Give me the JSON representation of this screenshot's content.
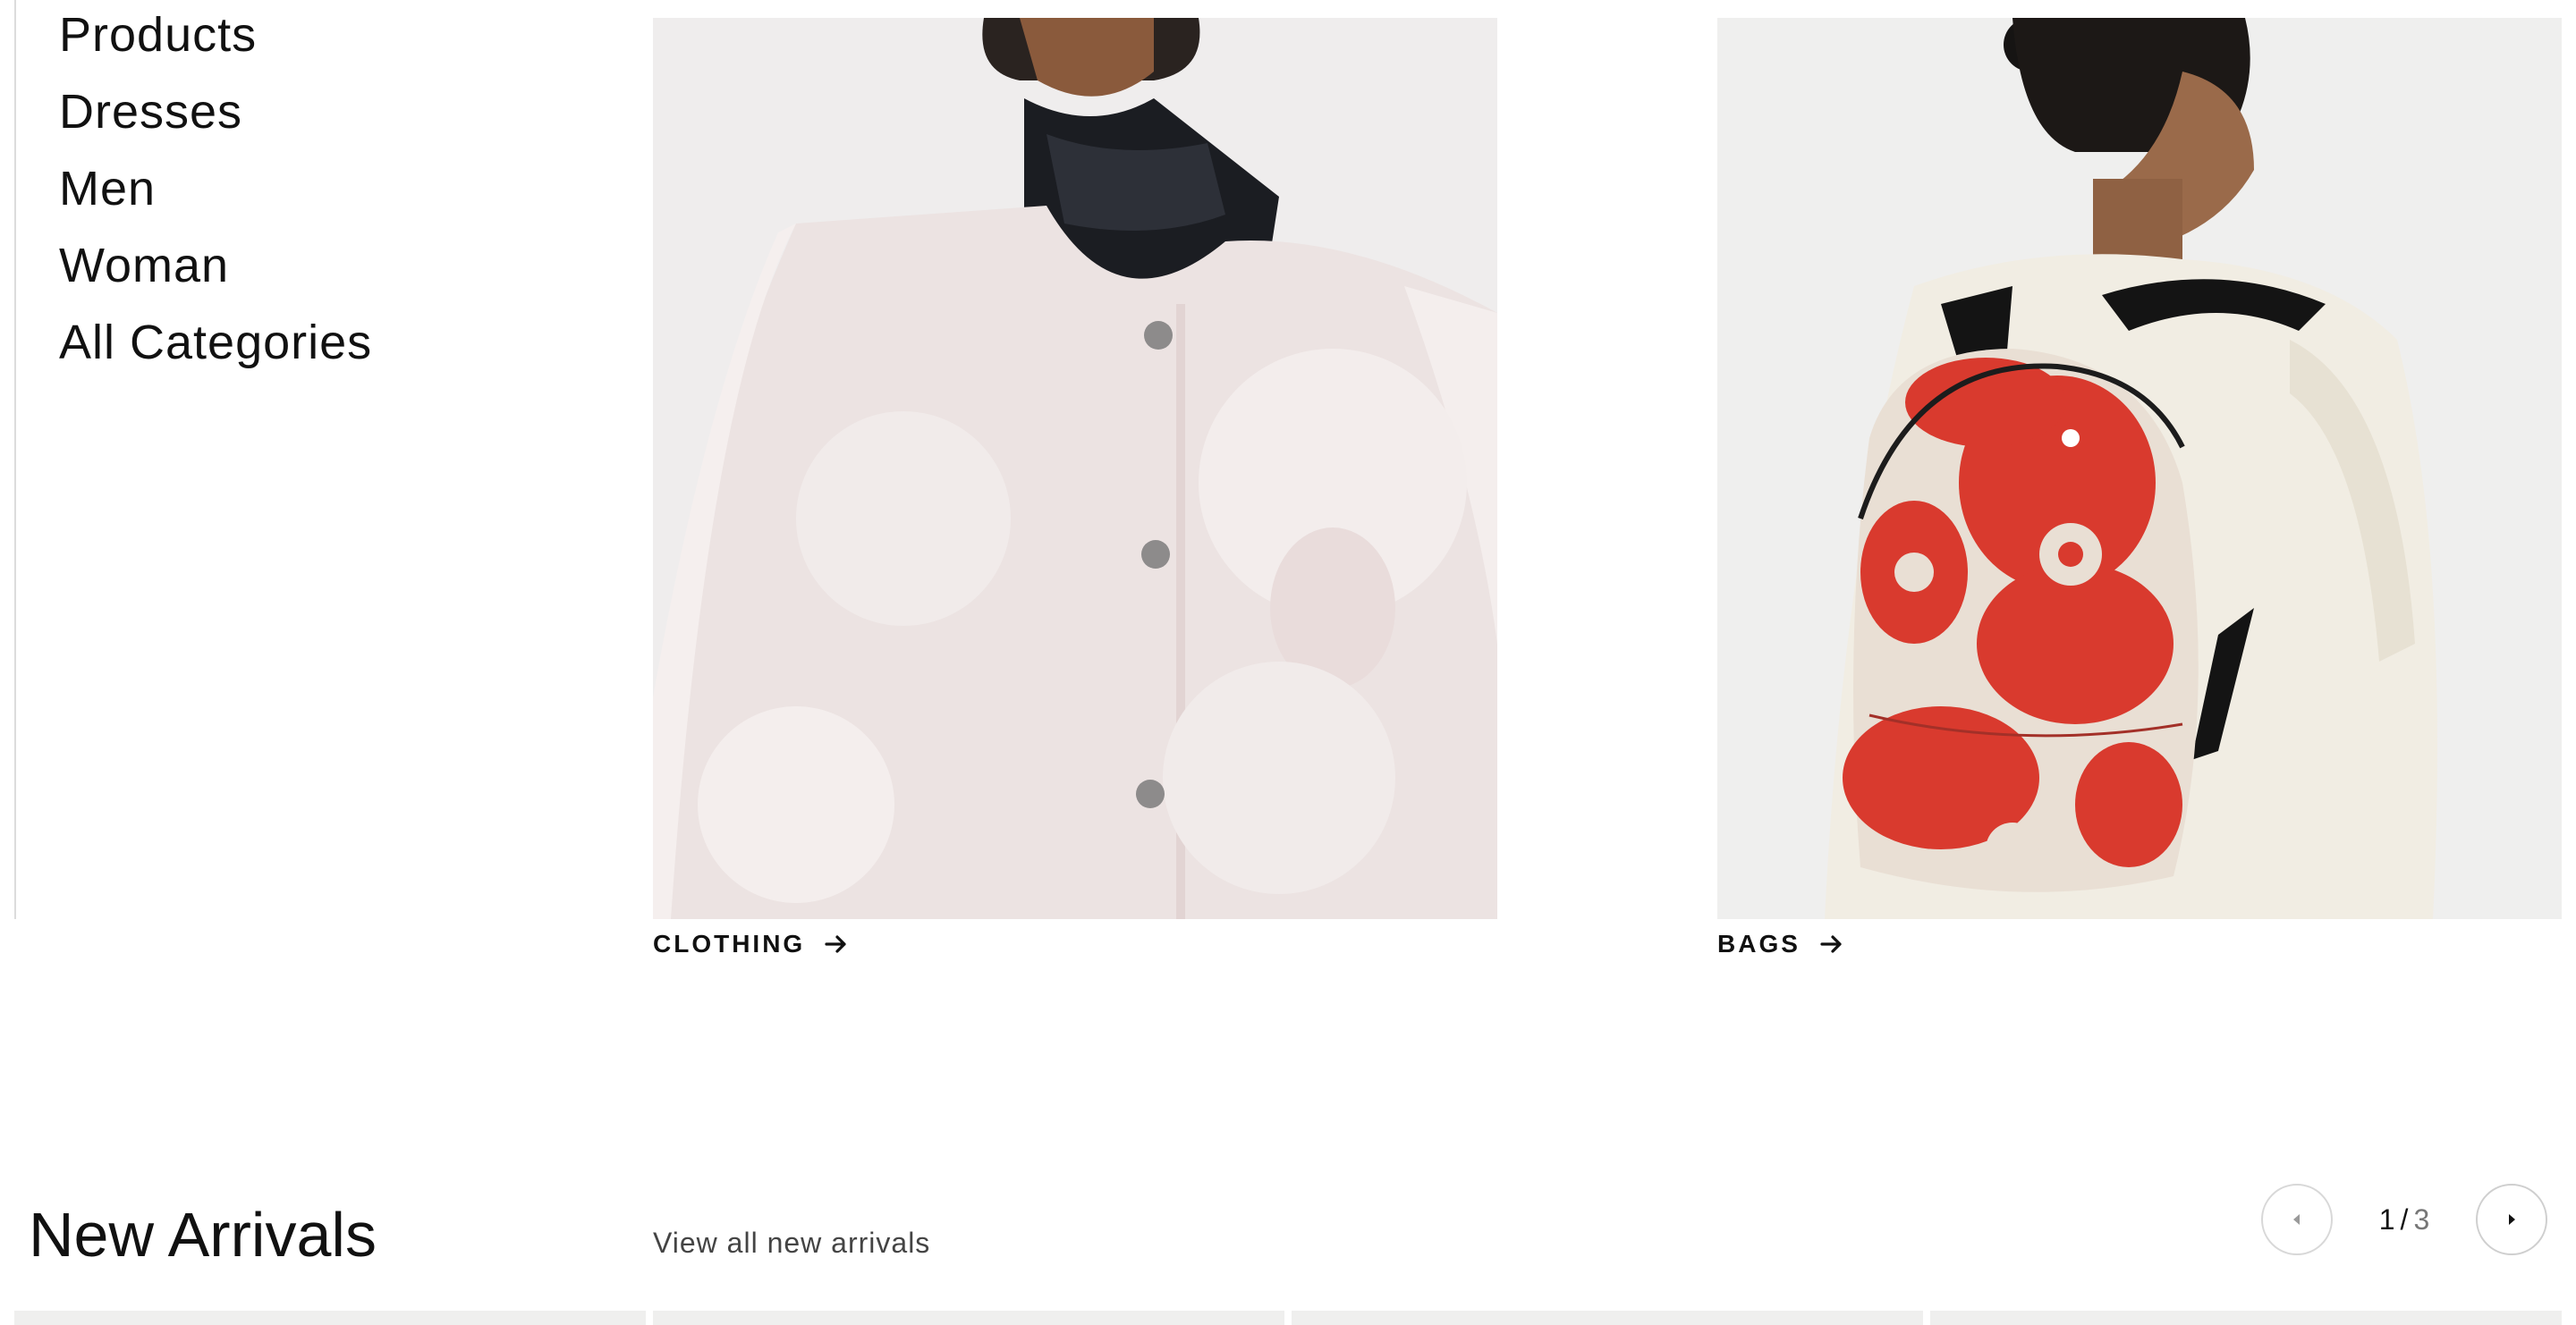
{
  "categories": {
    "items": [
      {
        "label": "Products"
      },
      {
        "label": "Dresses"
      },
      {
        "label": "Men"
      },
      {
        "label": "Woman"
      },
      {
        "label": "All Categories"
      }
    ]
  },
  "tiles": {
    "clothing": {
      "label": "CLOTHING",
      "icon": "arrow-right-icon"
    },
    "bags": {
      "label": "BAGS",
      "icon": "arrow-right-icon"
    }
  },
  "new_arrivals": {
    "title": "New Arrivals",
    "view_all_label": "View all new arrivals",
    "pager": {
      "current": "1",
      "separator": "/",
      "total": "3",
      "prev_icon": "caret-left-icon",
      "next_icon": "caret-right-icon"
    }
  },
  "colors": {
    "accent_red": "#d93a2e",
    "text": "#111111",
    "muted": "#777777"
  }
}
